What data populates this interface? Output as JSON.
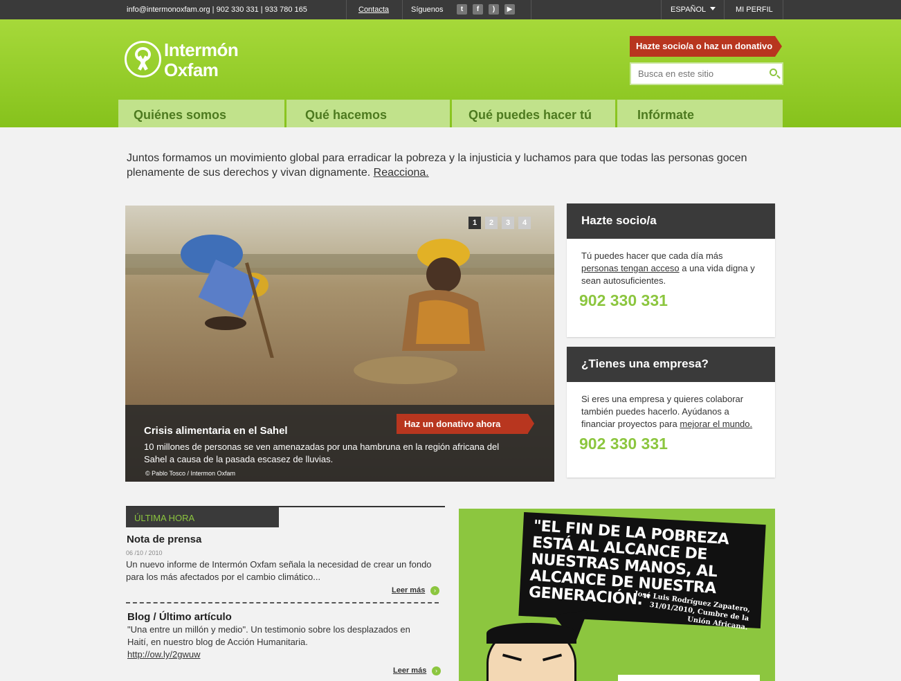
{
  "topbar": {
    "contact_info": "info@intermonoxfam.org  |  902 330 331  |  933 780 165",
    "contacta": "Contacta",
    "siguenos": "Síguenos",
    "social": [
      {
        "icon": "twitter-icon",
        "glyph": "t"
      },
      {
        "icon": "facebook-icon",
        "glyph": "f"
      },
      {
        "icon": "rss-icon",
        "glyph": ")"
      },
      {
        "icon": "youtube-icon",
        "glyph": "▶"
      }
    ],
    "language": "ESPAÑOL",
    "profile": "MI PERFIL"
  },
  "header": {
    "logo_line1": "Intermón",
    "logo_line2": "Oxfam",
    "donate_button": "Hazte socio/a o haz un donativo",
    "search_placeholder": "Busca en este sitio"
  },
  "nav": [
    "Quiénes somos",
    "Qué hacemos",
    "Qué puedes hacer tú",
    "Infórmate"
  ],
  "intro": {
    "text": "Juntos formamos un movimiento global para erradicar la pobreza y la injusticia y luchamos para que todas las personas gocen plenamente de sus derechos y vivan dignamente. ",
    "link": "Reacciona."
  },
  "hero": {
    "pager": [
      "1",
      "2",
      "3",
      "4"
    ],
    "active_page": 1,
    "title": "Crisis alimentaria en el Sahel",
    "description": "10 millones de personas se ven amenazadas por una hambruna en la región africana del Sahel a causa de la pasada escasez de lluvias.",
    "credit": "© Pablo Tosco / Intermon Oxfam",
    "donate_button": "Haz un donativo ahora"
  },
  "boxes": {
    "socio": {
      "title": "Hazte socio/a",
      "text_before": "Tú puedes hacer que cada día más ",
      "link": "personas tengan acceso",
      "text_after": " a una vida digna y sean autosuficientes.",
      "phone": "902 330 331"
    },
    "empresa": {
      "title": "¿Tienes una empresa?",
      "text_before": "Si eres una empresa y quieres colaborar también puedes hacerlo. Ayúdanos a financiar proyectos para ",
      "link": "mejorar el mundo.",
      "phone": "902 330 331"
    }
  },
  "news": {
    "label": "ÚLTIMA HORA",
    "item1": {
      "title": "Nota de prensa",
      "date": "06 /10 / 2010",
      "text": "Un nuevo informe de Intermón Oxfam señala la necesidad de crear un fondo para los más afectados por el cambio climático...",
      "more": "Leer más"
    },
    "item2": {
      "title": "Blog / Último artículo",
      "text": "\"Una entre un millón y medio\". Un testimonio sobre los desplazados en Haití, en nuestro blog de Acción Humanitaria.",
      "link": "http://ow.ly/2gwuw",
      "more": "Leer más"
    }
  },
  "quote": {
    "text": "\"EL FIN DE LA POBREZA ESTÁ AL ALCANCE DE NUESTRAS MANOS, AL ALCANCE DE NUESTRA GENERACIÓN.\"",
    "author": "José Luis Rodríguez Zapatero, 31/01/2010, Cumbre de la Unión Africana."
  },
  "colors": {
    "brand_green": "#8cc63f",
    "nav_bg": "#c1e28b",
    "dark": "#3a3a3a",
    "donate_red": "#b8361f"
  }
}
